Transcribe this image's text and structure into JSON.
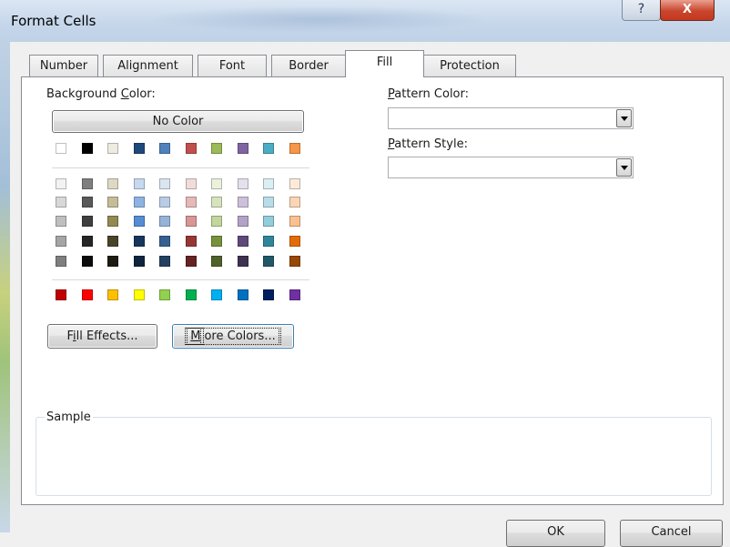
{
  "window": {
    "title": "Format Cells",
    "help_label": "?",
    "close_label": "X"
  },
  "tabs": [
    {
      "label": "Number"
    },
    {
      "label": "Alignment"
    },
    {
      "label": "Font"
    },
    {
      "label": "Border"
    },
    {
      "label": "Fill",
      "active": true
    },
    {
      "label": "Protection"
    }
  ],
  "fill": {
    "background_color_label_pre": "Background ",
    "background_color_label_key": "C",
    "background_color_label_post": "olor:",
    "no_color_label": "No Color",
    "theme_row": [
      "#ffffff",
      "#000000",
      "#eeece1",
      "#1f497d",
      "#4f81bd",
      "#c0504d",
      "#9bbb59",
      "#8064a2",
      "#4bacc6",
      "#f79646"
    ],
    "shade_rows": [
      [
        "#f2f2f2",
        "#7f7f7f",
        "#ddd9c3",
        "#c6d9f0",
        "#dbe5f1",
        "#f2dcdb",
        "#ebf1dd",
        "#e5e0ec",
        "#dbeef3",
        "#fdeada"
      ],
      [
        "#d8d8d8",
        "#595959",
        "#c4bd97",
        "#8db3e2",
        "#b8cce4",
        "#e5b9b7",
        "#d7e3bc",
        "#ccc1d9",
        "#b7dde8",
        "#fbd5b5"
      ],
      [
        "#bfbfbf",
        "#3f3f3f",
        "#938953",
        "#548dd4",
        "#95b3d7",
        "#d99694",
        "#c3d69b",
        "#b2a2c7",
        "#92cddc",
        "#fac08f"
      ],
      [
        "#a5a5a5",
        "#262626",
        "#494429",
        "#17365d",
        "#366092",
        "#953734",
        "#76923c",
        "#5f497a",
        "#31859b",
        "#e36c09"
      ],
      [
        "#7f7f7f",
        "#0c0c0c",
        "#1d1b10",
        "#0f243e",
        "#244061",
        "#632423",
        "#4f6128",
        "#3f3151",
        "#205867",
        "#974806"
      ]
    ],
    "standard_row": [
      "#c00000",
      "#ff0000",
      "#ffc000",
      "#ffff00",
      "#92d050",
      "#00b050",
      "#00b0f0",
      "#0070c0",
      "#002060",
      "#7030a0"
    ],
    "fill_effects_pre": "F",
    "fill_effects_key": "i",
    "fill_effects_post": "ll Effects...",
    "more_colors_key": "M",
    "more_colors_post": "ore Colors...",
    "pattern_color_key": "P",
    "pattern_color_post": "attern Color:",
    "pattern_color_value": "",
    "pattern_style_key": "P",
    "pattern_style_post": "attern Style:",
    "pattern_style_value": "",
    "sample_label": "Sample"
  },
  "footer": {
    "ok_label": "OK",
    "cancel_label": "Cancel"
  }
}
